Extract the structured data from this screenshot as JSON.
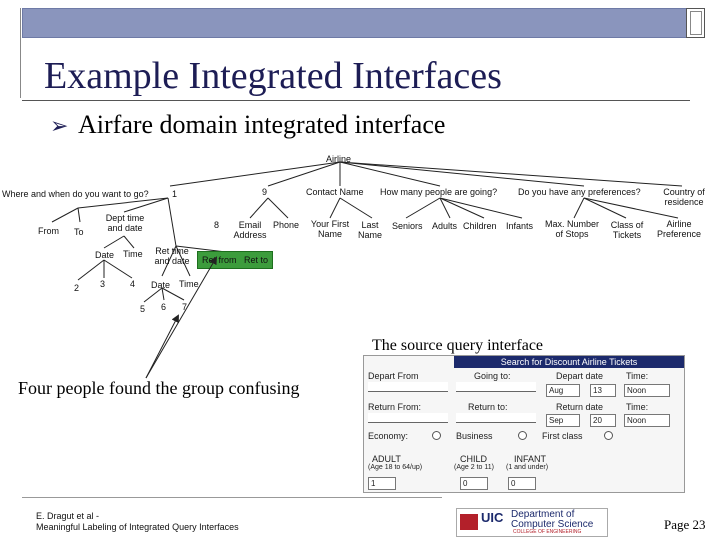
{
  "slide": {
    "title": "Example Integrated Interfaces",
    "bullet": "Airfare domain integrated interface",
    "source_caption": "The source query interface",
    "confusing_note": "Four people found the group confusing",
    "footer_line1": "E. Dragut et al -",
    "footer_line2": "Meaningful Labeling of Integrated Query Interfaces",
    "page": "Page 23",
    "bullet_icon": "arrow-bullet-icon"
  },
  "tree": {
    "root": "Airline",
    "where_when": "Where and when do you want to go?",
    "contact": "Contact Name",
    "how_many": "How many people are going?",
    "preferences": "Do you have any preferences?",
    "country": "Country of residence",
    "from": "From",
    "to": "To",
    "dept": "Dept time and date",
    "email": "Email Address",
    "phone": "Phone",
    "first": "Your First Name",
    "last": "Last Name",
    "seniors": "Seniors",
    "adults": "Adults",
    "children": "Children",
    "infants": "Infants",
    "max_stops": "Max. Number of Stops",
    "class": "Class of Tickets",
    "airline_pref": "Airline Preference",
    "date1": "Date",
    "time1": "Time",
    "ret_tad": "Ret time and date",
    "ret_from": "Ret from",
    "ret_to": "Ret to",
    "date2": "Date",
    "time2": "Time",
    "n1": "1",
    "n2": "2",
    "n3": "3",
    "n4": "4",
    "n5": "5",
    "n6": "6",
    "n7": "7",
    "n8": "8",
    "n9": "9"
  },
  "form": {
    "header": "Search for Discount Airline Tickets",
    "depart_from": "Depart From",
    "going_to": "Going to:",
    "depart_date": "Depart date",
    "time": "Time:",
    "return_from": "Return From:",
    "return_to": "Return to:",
    "return_date": "Return date",
    "time2": "Time:",
    "month1": "Aug",
    "day1": "13",
    "time_val1": "Noon",
    "month2": "Sep",
    "day2": "20",
    "time_val2": "Noon",
    "economy": "Economy:",
    "business": "Business",
    "first_class": "First class",
    "adult": "ADULT",
    "adult_age": "(Age 18 to 64/up)",
    "child": "CHILD",
    "child_age": "(Age 2 to 11)",
    "infant": "INFANT",
    "infant_age": "(1 and under)",
    "adult_val": "1",
    "child_val": "0",
    "infant_val": "0"
  },
  "logo": {
    "uic": "UIC",
    "dept1": "Department of",
    "dept2": "Computer Science",
    "college": "COLLEGE OF ENGINEERING"
  },
  "colors": {
    "topbar": "#8a95bd",
    "title": "#1d1d55",
    "green_box": "#3c9c3c",
    "form_header": "#1c2a6c",
    "logo_red": "#b3202a"
  }
}
